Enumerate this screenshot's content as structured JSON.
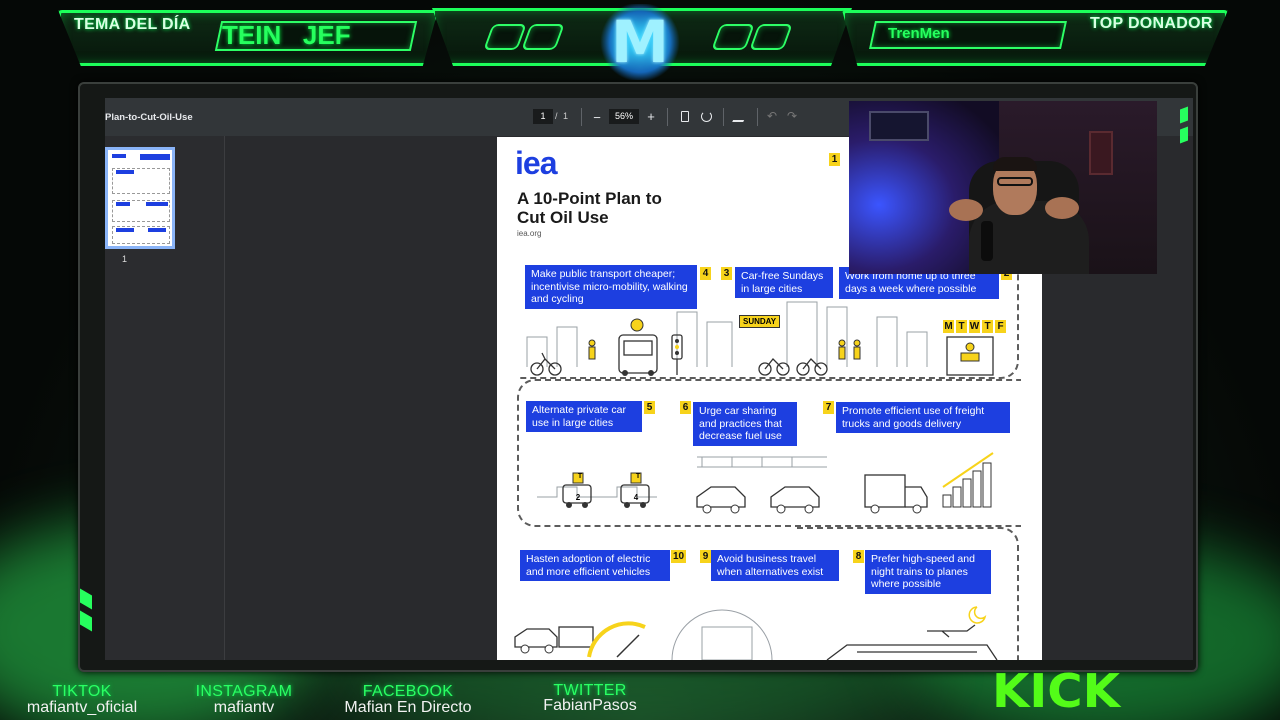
{
  "overlay": {
    "topic_label": "TEMA DEL DÍA",
    "topic_value": "TEIN   JEF",
    "logo_letter": "M",
    "donor_label": "TOP DONADOR",
    "donor_value": "TrenMen"
  },
  "viewer": {
    "doc_title": "Plan-to-Cut-Oil-Use",
    "page_current": "1",
    "page_sep": "/",
    "page_total": "1",
    "zoom": "56%",
    "zoom_out": "−",
    "zoom_in": "+",
    "thumb_label": "1"
  },
  "infographic": {
    "brand": "iea",
    "title_line1": "A 10-Point Plan to",
    "title_line2": "Cut Oil Use",
    "site": "iea.org",
    "sunday_sign": "SUNDAY",
    "days": [
      "M",
      "T",
      "W",
      "T",
      "F"
    ],
    "taxi_a": "2",
    "taxi_b": "4",
    "taxi_sign": "T",
    "points": [
      {
        "num": "1",
        "text": ""
      },
      {
        "num": "4",
        "text": "Make public transport cheaper; incentivise micro-mobility, walking and cycling"
      },
      {
        "num": "3",
        "text": "Car-free Sundays in large cities"
      },
      {
        "num": "2",
        "text": "Work from home up to three days a week where possible"
      },
      {
        "num": "5",
        "text": "Alternate private car use in large cities"
      },
      {
        "num": "6",
        "text": "Urge car sharing and practices that decrease fuel use"
      },
      {
        "num": "7",
        "text": "Promote efficient use of freight trucks and goods delivery"
      },
      {
        "num": "10",
        "text": "Hasten adoption of electric and more efficient vehicles"
      },
      {
        "num": "9",
        "text": "Avoid business travel when alternatives exist"
      },
      {
        "num": "8",
        "text": "Prefer high-speed and night trains to planes where possible"
      }
    ]
  },
  "socials": [
    {
      "label": "TIKTOK",
      "handle": "mafiantv_oficial"
    },
    {
      "label": "INSTAGRAM",
      "handle": "mafiantv"
    },
    {
      "label": "FACEBOOK",
      "handle": "Mafian En Directo"
    },
    {
      "label": "TWITTER",
      "handle": "FabianPasos"
    }
  ],
  "kick_logo": "KICK",
  "colors": {
    "accent": "#1cff5a",
    "iea_blue": "#1d3fe0",
    "iea_yellow": "#f7d31b"
  }
}
